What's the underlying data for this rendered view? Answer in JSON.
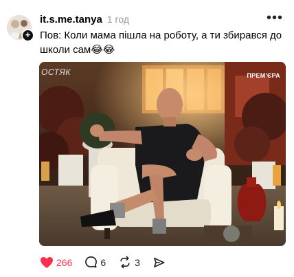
{
  "post": {
    "username": "it.s.me.tanya",
    "timestamp": "1 год",
    "caption": "Пов: Коли мама пішла на роботу, а ти збирався до школи сам😂😂",
    "more_icon": "more-dots-icon"
  },
  "media": {
    "watermark_left": "ОСТЯК",
    "watermark_right": "ПРЕМ'ЄРА"
  },
  "actions": {
    "likes": "266",
    "comments": "6",
    "reposts": "3",
    "like_color": "#ff2e4c",
    "icons": [
      "heart-icon",
      "comment-icon",
      "repost-icon",
      "share-icon"
    ]
  }
}
